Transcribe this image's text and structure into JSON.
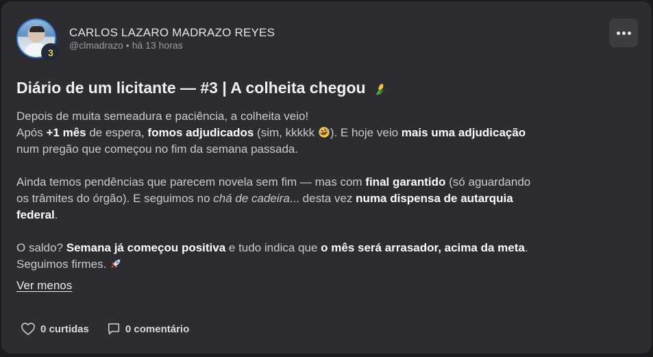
{
  "author": {
    "name": "CARLOS LAZARO MADRAZO REYES",
    "handle": "@clmadrazo",
    "separator": "•",
    "time": "há 13 horas",
    "level": "3"
  },
  "post": {
    "title": "Diário de um licitante — #3 | A colheita chegou",
    "title_emoji": "corn-icon",
    "p1_line1": "Depois de muita semeadura e paciência, a colheita veio!",
    "p1_a": "Após ",
    "p1_b": "+1 mês",
    "p1_c": " de espera, ",
    "p1_d": "fomos adjudicados",
    "p1_e": " (sim, kkkkk ",
    "p1_emoji": "rofl-face-icon",
    "p1_f": "). E hoje veio ",
    "p1_g": "mais uma adjudicação",
    "p1_h": " num pregão que começou no fim da semana passada.",
    "p2_a": "Ainda temos pendências que parecem novela sem fim — mas com ",
    "p2_b": "final garantido",
    "p2_c": " (só aguardando os trâmites do órgão). E seguimos no ",
    "p2_d": "chá de cadeira",
    "p2_e": "... desta vez ",
    "p2_f": "numa dispensa de autarquia federal",
    "p2_g": ".",
    "p3_a": "O saldo? ",
    "p3_b": "Semana já começou positiva",
    "p3_c": " e tudo indica que ",
    "p3_d": "o mês será arrasador, acima da meta",
    "p3_e": ". Seguimos firmes. ",
    "p3_emoji": "rocket-icon",
    "toggle_label": "Ver menos"
  },
  "actions": {
    "likes_label": "0 curtidas",
    "comments_label": "0 comentário"
  },
  "colors": {
    "card_bg": "#2d2d31",
    "page_bg": "#1b1b1e",
    "badge_text": "#f2c94c"
  }
}
